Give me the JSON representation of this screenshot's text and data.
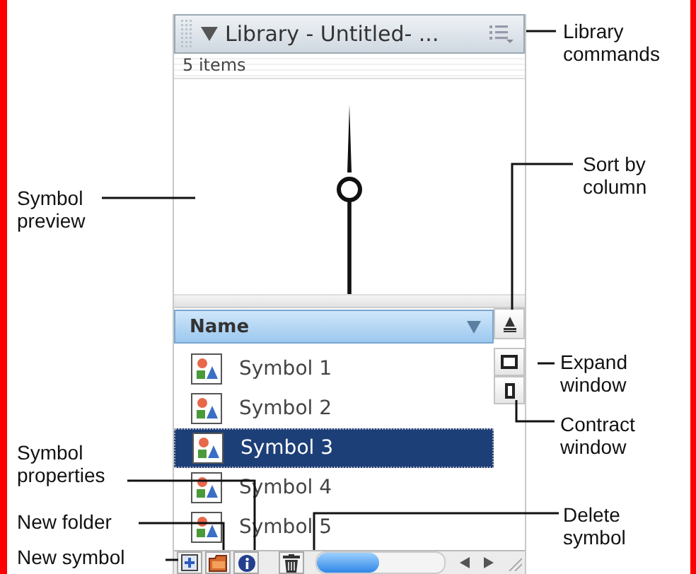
{
  "panel": {
    "title": "Library - Untitled- ...",
    "item_count": "5 items",
    "column_header": "Name",
    "items": [
      {
        "name": "Symbol 1",
        "selected": false
      },
      {
        "name": "Symbol 2",
        "selected": false
      },
      {
        "name": "Symbol 3",
        "selected": true
      },
      {
        "name": "Symbol 4",
        "selected": false
      },
      {
        "name": "Symbol 5",
        "selected": false
      }
    ]
  },
  "callouts": [
    {
      "text": "Library commands"
    },
    {
      "text": "Symbol preview"
    },
    {
      "text": "Sort by column"
    },
    {
      "text": "Expand window"
    },
    {
      "text": "Contract window"
    },
    {
      "text": "Symbol properties"
    },
    {
      "text": "New folder"
    },
    {
      "text": "New symbol"
    },
    {
      "text": "Delete symbol"
    }
  ]
}
